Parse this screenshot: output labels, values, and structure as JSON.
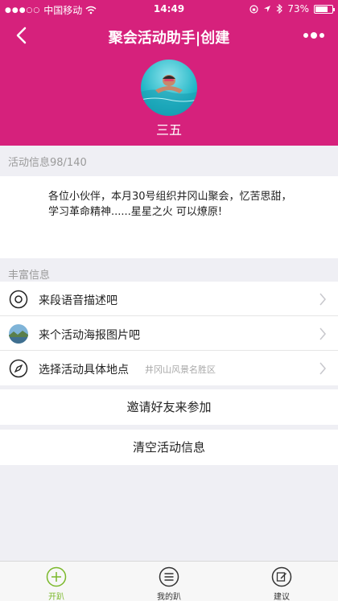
{
  "status": {
    "carrier": "中国移动",
    "time": "14:49",
    "battery": "73%",
    "battery_level": 0.73
  },
  "nav": {
    "title": "聚会活动助手|创建"
  },
  "profile": {
    "name": "三五"
  },
  "description": {
    "label": "活动信息98/140",
    "text": "各位小伙伴，本月30号组织井冈山聚会，忆苦思甜，学习革命精神......星星之火 可以燎原!"
  },
  "extras": {
    "label": "丰富信息",
    "rows": [
      {
        "label": "来段语音描述吧",
        "hint": ""
      },
      {
        "label": "来个活动海报图片吧",
        "hint": ""
      },
      {
        "label": "选择活动具体地点",
        "hint": "井冈山风景名胜区"
      }
    ]
  },
  "actions": {
    "invite": "邀请好友来参加",
    "clear": "清空活动信息"
  },
  "tabs": [
    {
      "label": "开趴",
      "active": true
    },
    {
      "label": "我的趴",
      "active": false
    },
    {
      "label": "建议",
      "active": false
    }
  ],
  "colors": {
    "brand": "#d6217c",
    "tab_active": "#7ab82a"
  }
}
